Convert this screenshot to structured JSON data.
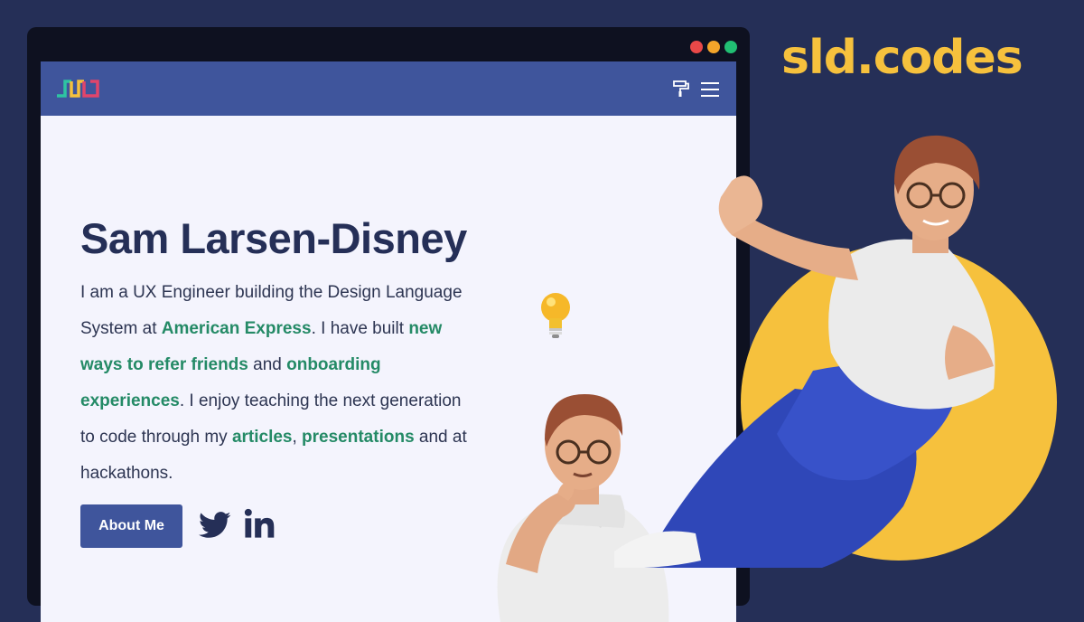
{
  "brand": "sld.codes",
  "colors": {
    "background": "#252f57",
    "accent_yellow": "#f6c13d",
    "nav": "#3f559c",
    "link_green": "#248a66",
    "text_dark": "#252f57"
  },
  "window": {
    "dots": [
      "#e94848",
      "#f3a52a",
      "#21bf73"
    ]
  },
  "nav": {
    "logo": "sld-logo-icon",
    "icons": [
      "paint-brush-icon",
      "hamburger-menu-icon"
    ]
  },
  "hero": {
    "name": "Sam Larsen-Disney",
    "bio": {
      "t1": "I am a UX Engineer building the Design Language System at ",
      "l1": "American Express",
      "t2": ". I have built ",
      "l2": "new ways to refer friends",
      "t3": " and ",
      "l3": "onboarding experiences",
      "t4": ". I enjoy teaching the next generation to code through my ",
      "l4": "articles",
      "t5": ", ",
      "l5": "presentations",
      "t6": " and at hackathons."
    },
    "about_button": "About Me",
    "social_icons": [
      "twitter-icon",
      "linkedin-icon"
    ]
  },
  "illustrations": [
    "lightbulb-icon",
    "thinking-person-illustration",
    "waving-person-illustration"
  ]
}
